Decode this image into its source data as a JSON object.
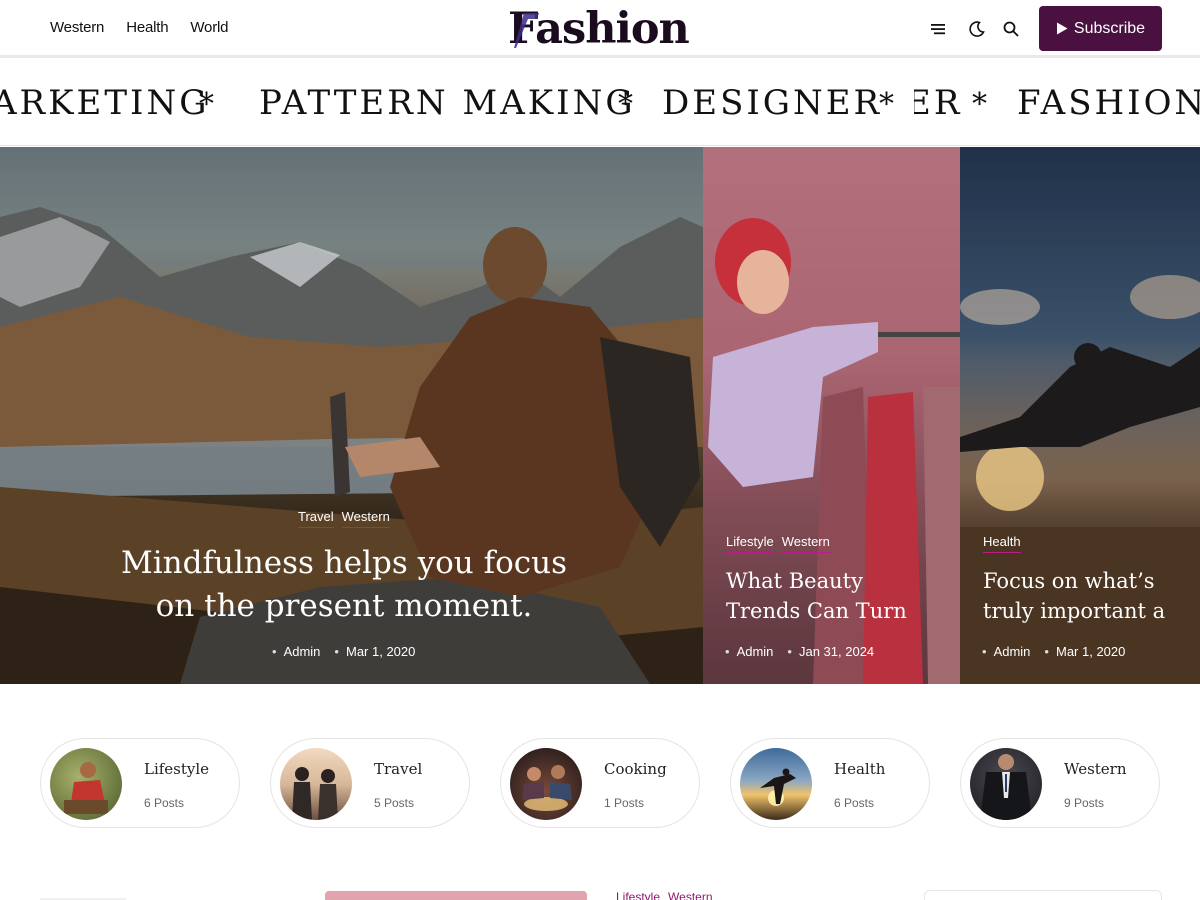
{
  "header": {
    "nav": [
      "Western",
      "Health",
      "World"
    ],
    "logo_text": "Fashion",
    "subscribe_label": "Subscribe"
  },
  "ticker": {
    "items": [
      "ARKETING",
      "PATTERN MAKING",
      "DESIGNER",
      "ER",
      "FASHION I"
    ],
    "separator": "*"
  },
  "hero": {
    "main": {
      "categories": [
        "Travel",
        "Western"
      ],
      "title_line1": "Mindfulness helps you focus",
      "title_line2": "on the present moment.",
      "author": "Admin",
      "date": "Mar 1, 2020"
    },
    "side1": {
      "categories": [
        "Lifestyle",
        "Western"
      ],
      "title_line1": "What Beauty",
      "title_line2": "Trends Can Turn",
      "author": "Admin",
      "date": "Jan 31, 2024"
    },
    "side2": {
      "categories": [
        "Health"
      ],
      "title_line1": "Focus on what’s",
      "title_line2": "truly important a",
      "author": "Admin",
      "date": "Mar 1, 2020"
    }
  },
  "categories": [
    {
      "name": "Lifestyle",
      "count": "6 Posts"
    },
    {
      "name": "Travel",
      "count": "5 Posts"
    },
    {
      "name": "Cooking",
      "count": "1 Posts"
    },
    {
      "name": "Health",
      "count": "6 Posts"
    },
    {
      "name": "Western",
      "count": "9 Posts"
    }
  ],
  "bottom": {
    "categories": [
      "Lifestyle",
      "Western"
    ]
  },
  "colors": {
    "brand": "#4a1140",
    "accent": "#c01b8a",
    "logo_mark": "#3b2a8a"
  },
  "icons": [
    "hamburger-menu-icon",
    "moon-icon",
    "search-icon",
    "play-icon"
  ]
}
